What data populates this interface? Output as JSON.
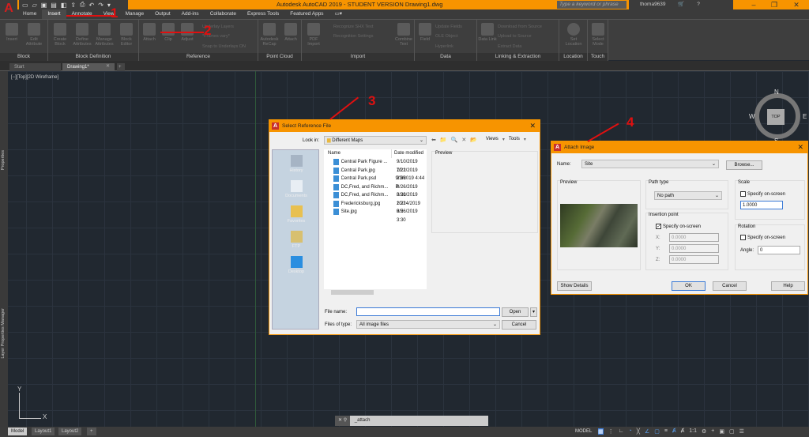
{
  "app": {
    "title": "Autodesk AutoCAD 2019 - STUDENT VERSION    Drawing1.dwg",
    "search_placeholder": "Type a keyword or phrase",
    "user": "thoma9639",
    "logo": "A"
  },
  "menu_tabs": [
    "Home",
    "Insert",
    "Annotate",
    "View",
    "Manage",
    "Output",
    "Add-ins",
    "Collaborate",
    "Express Tools",
    "Featured Apps"
  ],
  "ribbon": {
    "block": {
      "label": "Block",
      "buttons": [
        "Insert",
        "Edit Attribute"
      ]
    },
    "block_definition": {
      "label": "Block Definition",
      "buttons": [
        "Create Block",
        "Define Attributes",
        "Manage Attributes",
        "Block Editor"
      ]
    },
    "reference": {
      "label": "Reference",
      "buttons": [
        "Attach",
        "Clip",
        "Adjust"
      ],
      "small": [
        "Underlay Layers",
        "*Frames vary*",
        "Snap to Underlays ON"
      ]
    },
    "point_cloud": {
      "label": "Point Cloud",
      "buttons": [
        "Autodesk ReCap",
        "Attach"
      ]
    },
    "import": {
      "label": "Import",
      "buttons": [
        "PDF Import",
        "Combine Text"
      ],
      "small": [
        "Recognize SHX Text",
        "Recognition Settings"
      ]
    },
    "data": {
      "label": "Data",
      "buttons": [
        "Field"
      ],
      "small": [
        "Update Fields",
        "OLE Object",
        "Hyperlink"
      ]
    },
    "linking": {
      "label": "Linking & Extraction",
      "buttons": [
        "Data Link"
      ],
      "small": [
        "Download from Source",
        "Upload to Source",
        "Extract Data"
      ]
    },
    "location": {
      "label": "Location",
      "buttons": [
        "Set Location"
      ]
    },
    "touch": {
      "label": "Touch",
      "buttons": [
        "Select Mode"
      ]
    }
  },
  "doc_tabs": [
    "Start",
    "Drawing1*"
  ],
  "viewport_label": "[−][Top][2D Wireframe]",
  "side_palettes": [
    "Properties",
    "Layer Properties Manager"
  ],
  "viewcube": {
    "face": "TOP",
    "n": "N",
    "w": "W",
    "e": "E",
    "s": "S"
  },
  "ucs": {
    "x": "X",
    "y": "Y"
  },
  "command_line": {
    "value": "_attach"
  },
  "layout_tabs": [
    "Model",
    "Layout1",
    "Layout2"
  ],
  "status": {
    "model": "MODEL",
    "scale": "1:1"
  },
  "annotations": [
    "1",
    "2",
    "3",
    "4"
  ],
  "select_reference": {
    "title": "Select Reference File",
    "look_in_label": "Look in:",
    "look_in": "Different Maps",
    "views": "Views",
    "tools": "Tools",
    "places": [
      "History",
      "Documents",
      "Favorites",
      "FTP",
      "Desktop"
    ],
    "columns": [
      "Name",
      "Date modified"
    ],
    "files": [
      {
        "name": "Central Park Figure ...",
        "date": "9/10/2019 10:1"
      },
      {
        "name": "Central Park.jpg",
        "date": "7/22/2019 2:36"
      },
      {
        "name": "Central Park.psd",
        "date": "9/3/2019 4:44 P"
      },
      {
        "name": "DC,Fred, and Richm...",
        "date": "8/26/2019 3:21"
      },
      {
        "name": "DC,Fred, and Richm...",
        "date": "8/30/2019 2:21"
      },
      {
        "name": "Fredericksburg.jpg",
        "date": "10/24/2019 9:5"
      },
      {
        "name": "Site.jpg",
        "date": "8/26/2019 3:30"
      }
    ],
    "preview_label": "Preview",
    "file_name_label": "File name:",
    "file_name": "",
    "files_of_type_label": "Files of type:",
    "files_of_type": "All image files",
    "open": "Open",
    "cancel": "Cancel"
  },
  "attach_image": {
    "title": "Attach Image",
    "name_label": "Name:",
    "name": "Site",
    "browse": "Browse...",
    "preview_label": "Preview",
    "path_type_label": "Path type",
    "path_type": "No path",
    "insertion_label": "Insertion point",
    "insertion_specify": "Specify on-screen",
    "insertion_checked": true,
    "x_label": "X:",
    "x": "0.0000",
    "y_label": "Y:",
    "y": "0.0000",
    "z_label": "Z:",
    "z": "0.0000",
    "scale_label": "Scale",
    "scale_specify": "Specify on-screen",
    "scale_checked": false,
    "scale": "1.0000",
    "rotation_label": "Rotation",
    "rotation_specify": "Specify on-screen",
    "rotation_checked": false,
    "angle_label": "Angle:",
    "angle": "0",
    "show_details": "Show Details",
    "ok": "OK",
    "cancel": "Cancel",
    "help": "Help"
  }
}
